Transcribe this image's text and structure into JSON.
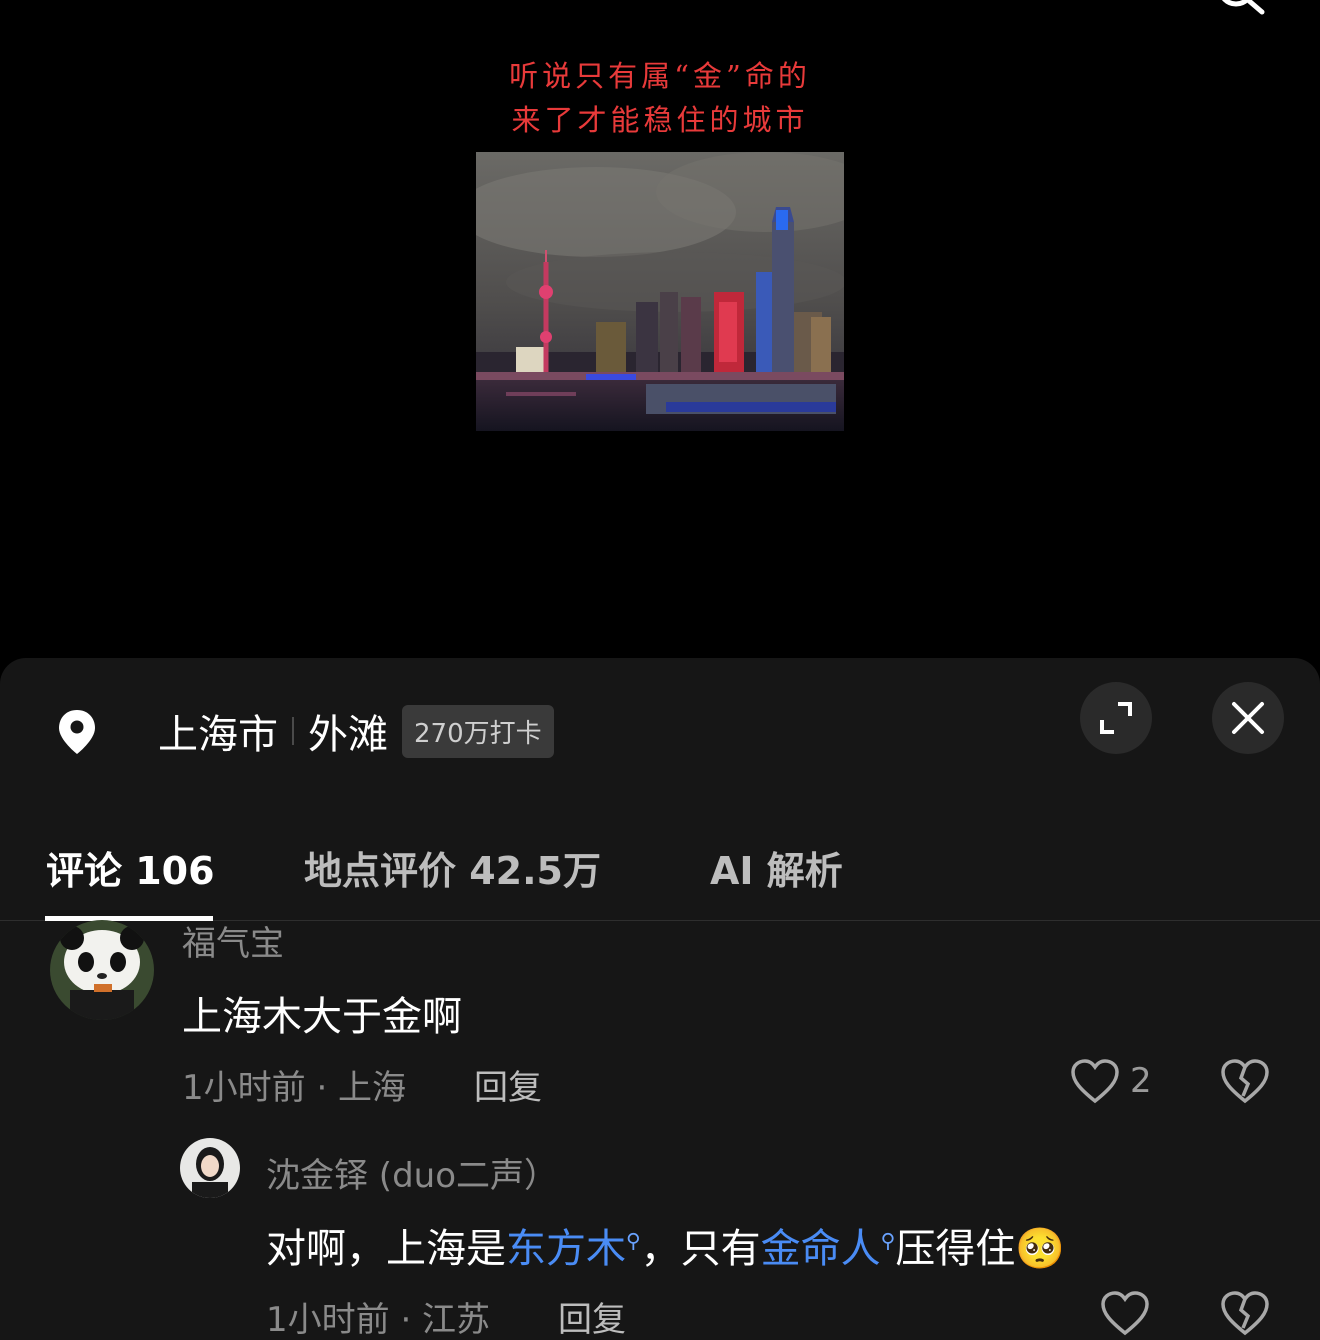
{
  "caption": {
    "line1": "听说只有属“金”命的",
    "line2": "来了才能稳住的城市"
  },
  "location": {
    "city": "上海市",
    "place": "外滩",
    "checkins": "270万打卡"
  },
  "tabs": [
    {
      "label": "评论 106",
      "active": true
    },
    {
      "label": "地点评价 42.5万",
      "active": false
    },
    {
      "label": "AI 解析",
      "active": false
    }
  ],
  "comments": [
    {
      "user": "福气宝",
      "text": "上海木大于金啊",
      "time_location": "1小时前 · 上海",
      "reply_label": "回复",
      "likes": "2"
    }
  ],
  "replies": [
    {
      "user": "沈金铎 (duo二声）",
      "text_part1": "对啊，上海是",
      "topic1": "东方木",
      "text_part2": "，只有",
      "topic2": "金命人",
      "text_part3": "压得住",
      "emoji": "🥺",
      "time_location": "1小时前 · 江苏",
      "reply_label": "回复"
    }
  ],
  "icons": {
    "search": "search-icon",
    "location": "location-pin-icon",
    "expand": "expand-icon",
    "close": "close-icon",
    "like": "heart-icon",
    "dislike": "broken-heart-icon"
  },
  "colors": {
    "accent_link": "#4a8cf5",
    "caption_red": "#e83a3a",
    "sheet_bg": "#161616"
  }
}
